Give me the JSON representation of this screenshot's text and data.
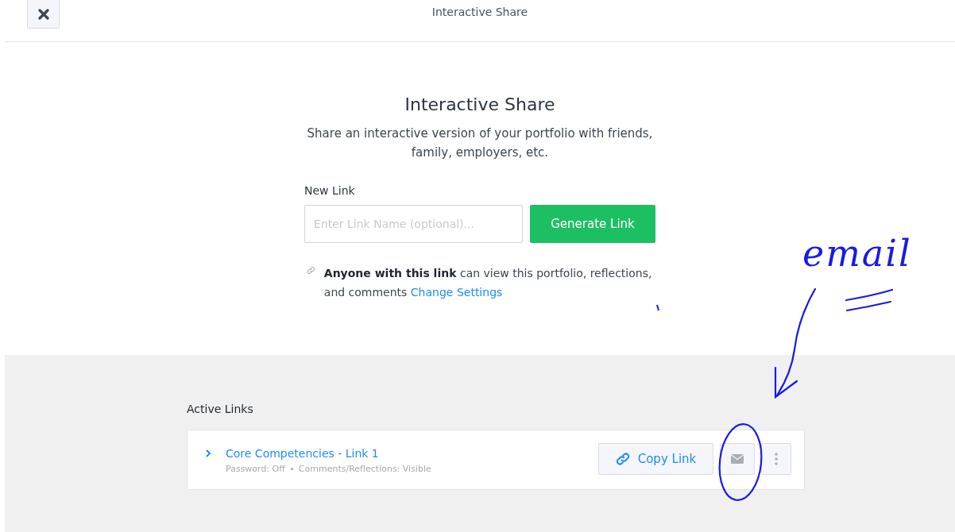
{
  "header": {
    "title": "Interactive Share"
  },
  "intro": {
    "heading": "Interactive Share",
    "description": "Share an interactive version of your portfolio with friends, family, employers, etc."
  },
  "new_link": {
    "label": "New Link",
    "field": {
      "placeholder": "Enter Link Name (optional)..."
    },
    "button": "Generate Link"
  },
  "notice": {
    "text": "**Anyone with this link** can view this portfolio, reflections, and comments",
    "link": "Change Settings"
  },
  "active_links": {
    "title": "Active Links",
    "links": [
      {
        "name": "Core Competencies - Link 1",
        "expanded": false,
        "details": [
          "Password: Off",
          "Comments/Reflections: Visible"
        ],
        "copy_button": "Copy Link"
      }
    ]
  },
  "annotation": {
    "text": "email"
  }
}
